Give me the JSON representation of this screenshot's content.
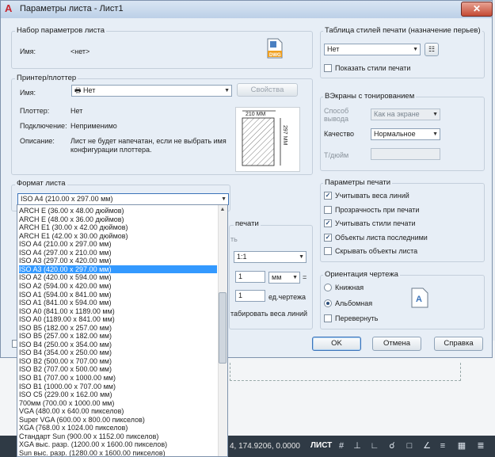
{
  "window": {
    "title": "Параметры листа - Лист1"
  },
  "page_setup": {
    "group_title": "Набор параметров листа",
    "name_label": "Имя:",
    "name_value": "<нет>"
  },
  "printer": {
    "group_title": "Принтер/плоттер",
    "name_label": "Имя:",
    "selected": "Нет",
    "properties_button": "Свойства",
    "plotter_label": "Плоттер:",
    "plotter_value": "Нет",
    "connection_label": "Подключение:",
    "connection_value": "Неприменимо",
    "description_label": "Описание:",
    "description_value_1": "Лист не будет напечатан, если не выбрать имя",
    "description_value_2": "конфигурации плоттера.",
    "preview_width": "210 MM",
    "preview_height": "297 MM"
  },
  "paper_size": {
    "group_title": "Формат листа",
    "selected": "ISO A4 (210.00 x 297.00 мм)",
    "options": [
      "ARCH E (36.00 x 48.00 дюймов)",
      "ARCH E (48.00 x 36.00 дюймов)",
      "ARCH E1 (30.00 x 42.00 дюймов)",
      "ARCH E1 (42.00 x 30.00 дюймов)",
      "ISO A4 (210.00 x 297.00 мм)",
      "ISO A4 (297.00 x 210.00 мм)",
      "ISO A3 (297.00 x 420.00 мм)",
      "ISO A3 (420.00 x 297.00 мм)",
      "ISO A2 (420.00 x 594.00 мм)",
      "ISO A2 (594.00 x 420.00 мм)",
      "ISO A1 (594.00 x 841.00 мм)",
      "ISO A1 (841.00 x 594.00 мм)",
      "ISO A0 (841.00 x 1189.00 мм)",
      "ISO A0 (1189.00 x 841.00 мм)",
      "ISO B5 (182.00 x 257.00 мм)",
      "ISO B5 (257.00 x 182.00 мм)",
      "ISO B4 (250.00 x 354.00 мм)",
      "ISO B4 (354.00 x 250.00 мм)",
      "ISO B2 (500.00 x 707.00 мм)",
      "ISO B2 (707.00 x 500.00 мм)",
      "ISO B1 (707.00 x 1000.00 мм)",
      "ISO B1 (1000.00 x 707.00 мм)",
      "ISO C5 (229.00 x 162.00 мм)",
      "700мм (700.00 x 1000.00 мм)",
      "VGA (480.00 x 640.00 пикселов)",
      "Super VGA (600.00 x 800.00 пикселов)",
      "XGA (768.00 x 1024.00 пикселов)",
      "Стандарт Sun (900.00 x 1152.00 пикселов)",
      "XGA выс. разр. (1200.00 x 1600.00 пикселов)",
      "Sun выс. разр. (1280.00 x 1600.00 пикселов)"
    ],
    "highlighted_index": 7
  },
  "plot_scale": {
    "group_title_fragment": "печати",
    "fragment_label": "ть",
    "scale_value": "1:1",
    "value_1": "1",
    "unit": "мм",
    "equals": "=",
    "value_2": "1",
    "unit_label": "ед.чертежа",
    "lineweights_fragment": "табировать веса линий"
  },
  "plot_style": {
    "group_title": "Таблица стилей печати (назначение перьев)",
    "selected": "Нет",
    "show_styles_label": "Показать стили печати",
    "show_styles_checked": false
  },
  "shaded": {
    "group_title": "ВЭкраны с тонированием",
    "mode_label_1": "Способ",
    "mode_label_2": "вывода",
    "mode_value": "Как на экране",
    "quality_label": "Качество",
    "quality_value": "Нормальное",
    "dpi_label": "Т/дюйм"
  },
  "plot_options": {
    "group_title": "Параметры печати",
    "items": [
      {
        "label": "Учитывать веса линий",
        "checked": true
      },
      {
        "label": "Прозрачность при печати",
        "checked": false
      },
      {
        "label": "Учитывать стили печати",
        "checked": true
      },
      {
        "label": "Объекты листа последними",
        "checked": true
      },
      {
        "label": "Скрывать объекты листа",
        "checked": false
      }
    ]
  },
  "orientation": {
    "group_title": "Ориентация чертежа",
    "portrait": "Книжная",
    "landscape": "Альбомная",
    "upside_down": "Перевернуть",
    "selected": "landscape"
  },
  "buttons": {
    "ok": "OK",
    "cancel": "Отмена",
    "help": "Справка"
  },
  "status": {
    "coords": "4, 174.9206, 0.0000",
    "mode": "ЛИСТ"
  },
  "colors": {
    "accent_blue": "#3399ff",
    "close_red": "#c44a34",
    "status_bg": "#2f3a45"
  }
}
